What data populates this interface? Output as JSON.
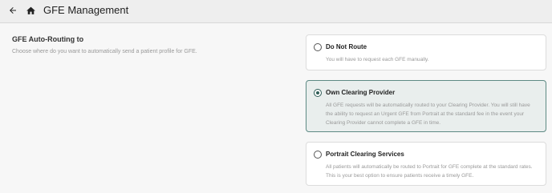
{
  "header": {
    "title": "GFE Management",
    "back_icon": "back-arrow-icon",
    "home_icon": "home-icon"
  },
  "section": {
    "title": "GFE Auto-Routing to",
    "description": "Choose where do you want to automatically send a patient profile for GFE."
  },
  "options": [
    {
      "title": "Do Not Route",
      "description": "You will have to request each GFE manually.",
      "selected": false
    },
    {
      "title": "Own Clearing Provider",
      "description": "All GFE requests will be automatically routed to your Clearing Provider. You will still have the ability to request an Urgent GFE from Portrait at the standard fee in the event your Clearing Provider cannot complete a GFE in time.",
      "selected": true
    },
    {
      "title": "Portrait Clearing Services",
      "description": "All patients will automatically be routed to Portrait for GFE complete at the standard rates. This is your best option to ensure patients receive a timely GFE.",
      "selected": false
    }
  ],
  "colors": {
    "accent": "#2f5d57",
    "selected_bg": "#e9eeed",
    "selected_border": "#5e8a84"
  }
}
